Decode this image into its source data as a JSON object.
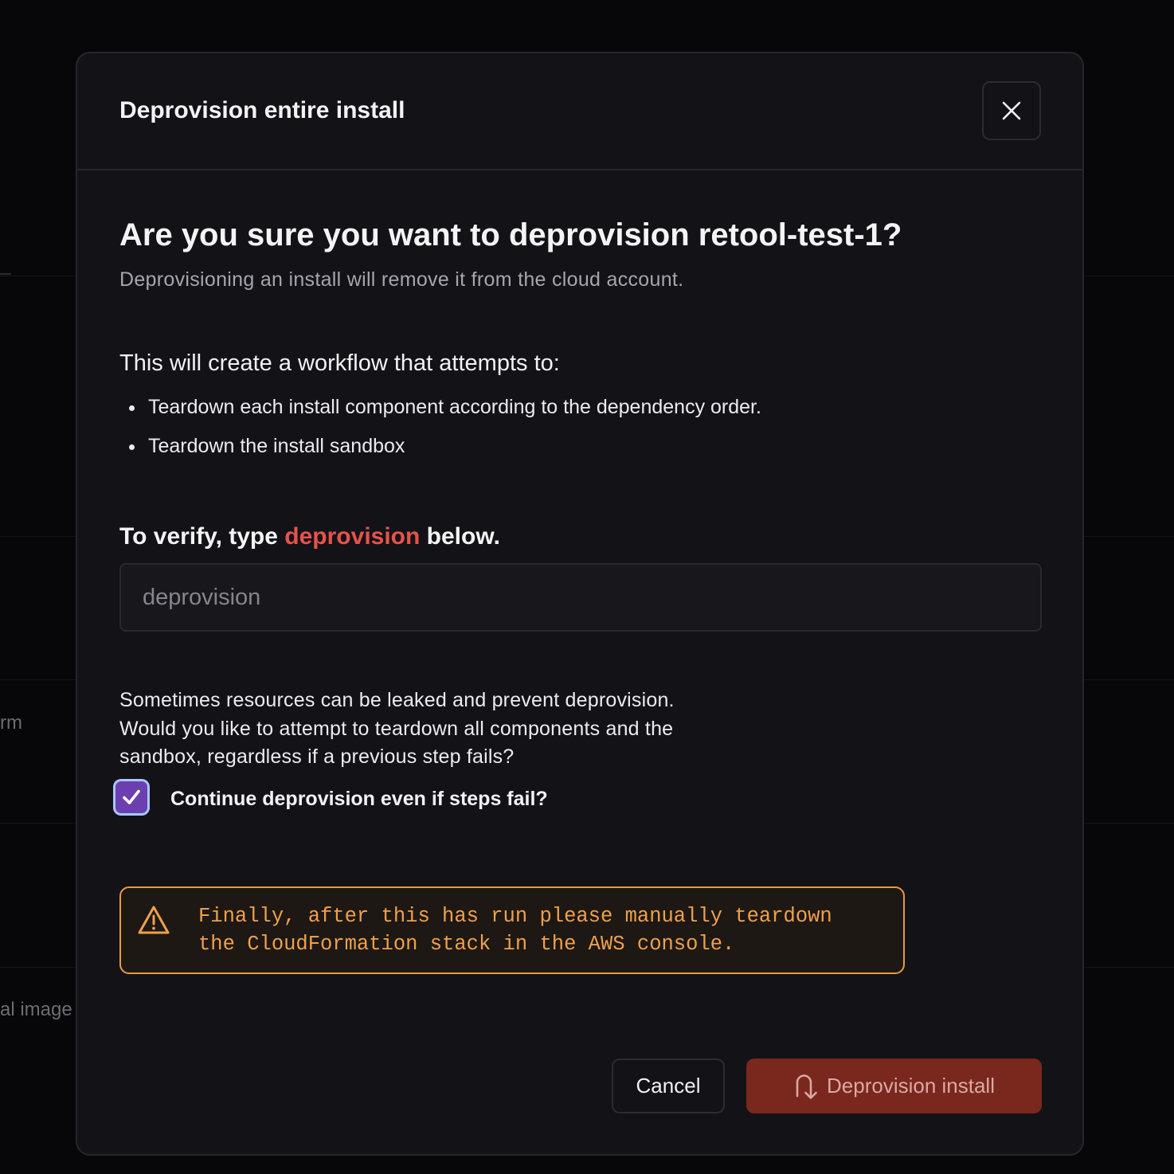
{
  "background": {
    "fragment_1": "rm",
    "fragment_2": "al image"
  },
  "modal": {
    "title": "Deprovision entire install",
    "close_icon": "close-icon",
    "heading": "Are you sure you want to deprovision retool-test-1?",
    "subheading": "Deprovisioning an install will remove it from the cloud account.",
    "workflow_title": "This will create a workflow that attempts to:",
    "workflow_steps": [
      "Teardown each install component according to the dependency order.",
      "Teardown the install sandbox"
    ],
    "verify": {
      "prefix": "To verify, type",
      "keyword": "deprovision",
      "suffix": "below.",
      "input_value": "",
      "input_placeholder": "deprovision"
    },
    "leak_note_lines": [
      "Sometimes resources can be leaked and prevent deprovision.",
      "Would you like to attempt to teardown all components and the",
      "sandbox, regardless if a previous step fails?"
    ],
    "continue_checkbox": {
      "label": "Continue deprovision even if steps fail?",
      "checked": true
    },
    "warning": {
      "icon": "warning-triangle-icon",
      "lines": [
        "Finally, after this has run please manually teardown",
        "the CloudFormation stack in the AWS console."
      ]
    },
    "buttons": {
      "cancel": "Cancel",
      "confirm": "Deprovision install",
      "confirm_icon": "undo-arrow-icon"
    }
  },
  "colors": {
    "danger_text": "#e5534b",
    "danger_button": "#7a271e",
    "warning_accent": "#f0a04b",
    "checkbox": "#6b3fb0",
    "modal_bg": "#131217"
  }
}
